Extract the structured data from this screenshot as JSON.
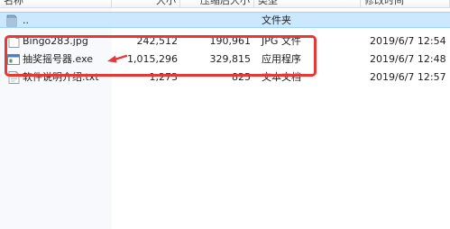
{
  "columns": {
    "name": "名称",
    "size": "大小",
    "compressed": "压缩后大小",
    "type": "类型",
    "modified": "修改时间"
  },
  "rows": [
    {
      "name": "..",
      "size": "",
      "compressed": "",
      "type": "文件夹",
      "modified": "",
      "icon": "folder-icon"
    },
    {
      "name": "Bingo283.jpg",
      "size": "242,512",
      "compressed": "190,961",
      "type": "JPG 文件",
      "modified": "2019/6/7 12:54",
      "icon": "image-file-icon"
    },
    {
      "name": "抽奖摇号器.exe",
      "size": "1,015,296",
      "compressed": "329,815",
      "type": "应用程序",
      "modified": "2019/6/7 12:48",
      "icon": "application-icon"
    },
    {
      "name": "软件说明介绍.txt",
      "size": "1,273",
      "compressed": "825",
      "type": "文本文档",
      "modified": "2019/6/7 12:57",
      "icon": "text-file-icon"
    }
  ],
  "colors": {
    "selection": "#cce8ff",
    "annotation": "#e53935"
  }
}
